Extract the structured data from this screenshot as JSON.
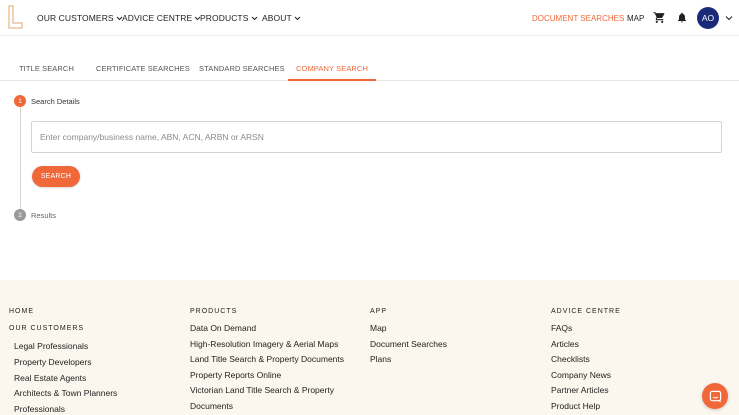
{
  "header": {
    "nav": [
      {
        "label": "OUR CUSTOMERS"
      },
      {
        "label": "ADVICE CENTRE"
      },
      {
        "label": "PRODUCTS"
      },
      {
        "label": "ABOUT"
      }
    ],
    "document_searches": "DOCUMENT SEARCHES",
    "map": "MAP",
    "avatar_initials": "AO",
    "accent_color": "#f0683a",
    "avatar_color": "#1b2a78"
  },
  "tabs": [
    {
      "label": "TITLE SEARCH"
    },
    {
      "label": "CERTIFICATE SEARCHES"
    },
    {
      "label": "STANDARD SEARCHES"
    },
    {
      "label": "COMPANY SEARCH",
      "active": true
    }
  ],
  "stepper": {
    "step1": {
      "number": "1",
      "label": "Search Details"
    },
    "step2": {
      "number": "2",
      "label": "Results"
    }
  },
  "search": {
    "placeholder": "Enter company/business name, ABN, ACN, ARBN or ARSN",
    "value": "",
    "button_label": "SEARCH"
  },
  "footer": {
    "col1": {
      "head1": "HOME",
      "head2": "OUR CUSTOMERS",
      "links": [
        "Legal Professionals",
        "Property Developers",
        "Real Estate Agents",
        "Architects & Town Planners",
        "Professionals"
      ]
    },
    "col2": {
      "head": "PRODUCTS",
      "links": [
        "Data On Demand",
        "High-Resolution Imagery & Aerial Maps",
        "Land Title Search & Property Documents",
        "Property Reports Online",
        "Victorian Land Title Search & Property",
        "Documents"
      ]
    },
    "col3": {
      "head": "APP",
      "links": [
        "Map",
        "Document Searches",
        "Plans"
      ]
    },
    "col4": {
      "head": "ADVICE CENTRE",
      "links": [
        "FAQs",
        "Articles",
        "Checklists",
        "Company News",
        "Partner Articles",
        "Product Help"
      ]
    }
  },
  "icons": [
    "logo-icon",
    "chevron-down-icon",
    "cart-icon",
    "bell-icon",
    "chat-icon"
  ]
}
